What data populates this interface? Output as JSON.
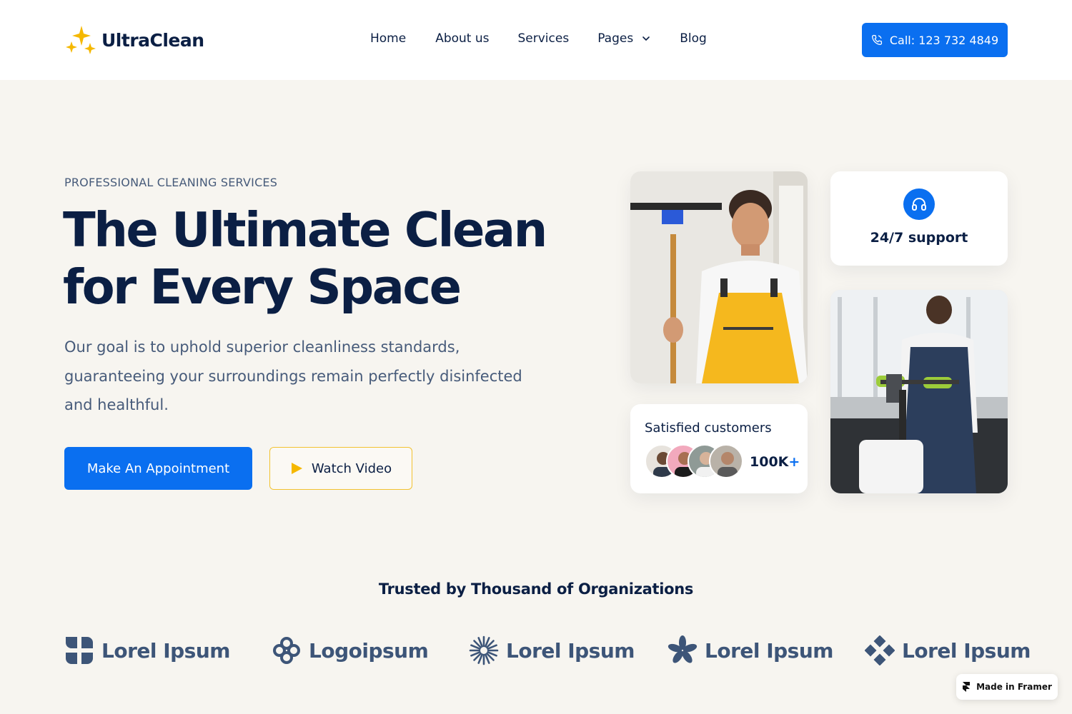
{
  "brand": {
    "name": "UltraClean",
    "star_color": "#f5b800"
  },
  "nav": {
    "items": [
      {
        "label": "Home"
      },
      {
        "label": "About us"
      },
      {
        "label": "Services"
      },
      {
        "label": "Pages",
        "has_dropdown": true
      },
      {
        "label": "Blog"
      }
    ],
    "call_label": "Call: 123 732 4849"
  },
  "hero": {
    "eyebrow": "PROFESSIONAL CLEANING SERVICES",
    "title_line1": "The Ultimate Clean",
    "title_line2": "for Every Space",
    "description": "Our goal is to uphold superior cleanliness standards, guaranteeing your surroundings remain perfectly disinfected and healthful.",
    "primary_cta": "Make An Appointment",
    "secondary_cta": "Watch Video"
  },
  "support_card": {
    "label": "24/7 support",
    "icon": "headphones-icon"
  },
  "customers_card": {
    "title": "Satisfied customers",
    "count": "100K",
    "count_suffix": "+"
  },
  "trusted": {
    "heading": "Trusted by Thousand of Organizations",
    "logos": [
      {
        "name": "Lorel Ipsum",
        "icon": "petal-logo-icon"
      },
      {
        "name": "Logoipsum",
        "icon": "knot-logo-icon"
      },
      {
        "name": "Lorel Ipsum",
        "icon": "sunburst-logo-icon"
      },
      {
        "name": "Lorel Ipsum",
        "icon": "asterisk-logo-icon"
      },
      {
        "name": "Lorel Ipsum",
        "icon": "diamond-logo-icon"
      }
    ]
  },
  "badge": {
    "label": "Made in Framer"
  },
  "colors": {
    "accent": "#0a6ff0",
    "navy": "#0b1f44",
    "background": "#f7f5f0",
    "yellow": "#f2c230"
  }
}
